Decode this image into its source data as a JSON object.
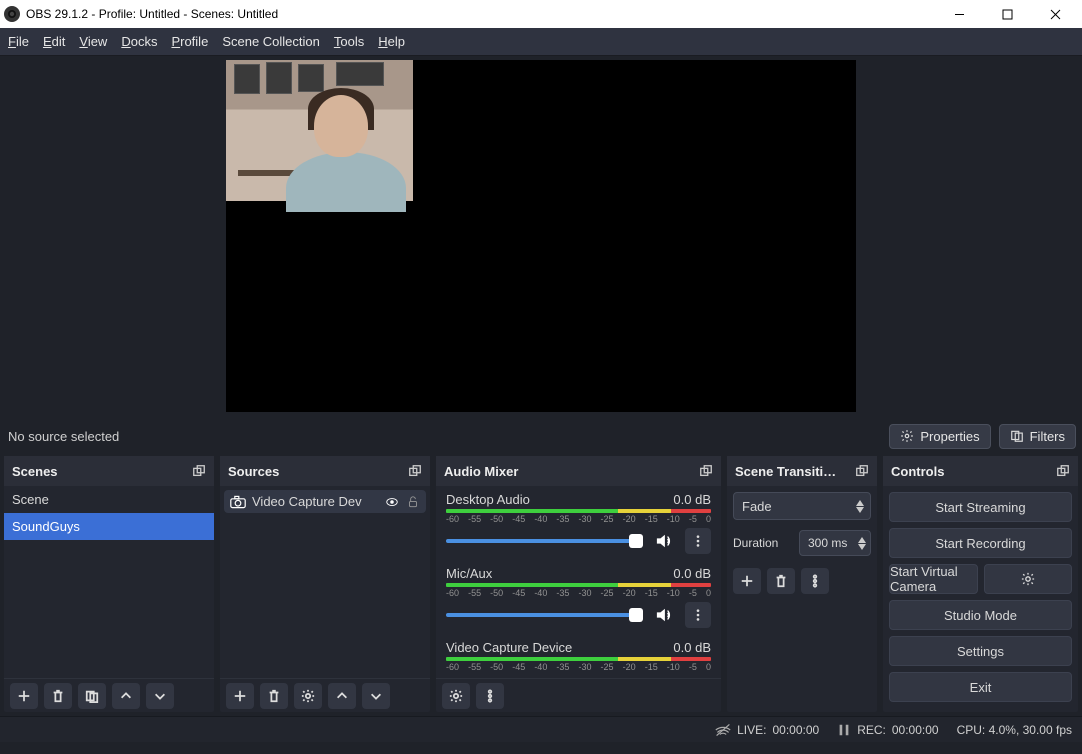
{
  "titlebar": {
    "text": "OBS 29.1.2 - Profile: Untitled - Scenes: Untitled"
  },
  "menu": {
    "file": "File",
    "edit": "Edit",
    "view": "View",
    "docks": "Docks",
    "profile": "Profile",
    "scene_collection": "Scene Collection",
    "tools": "Tools",
    "help": "Help"
  },
  "toolbar": {
    "no_source": "No source selected",
    "properties": "Properties",
    "filters": "Filters"
  },
  "docks": {
    "scenes": "Scenes",
    "sources": "Sources",
    "mixer": "Audio Mixer",
    "transitions": "Scene Transiti…",
    "controls": "Controls"
  },
  "scenes": {
    "items": [
      {
        "label": "Scene"
      },
      {
        "label": "SoundGuys"
      }
    ]
  },
  "sources": {
    "items": [
      {
        "label": "Video Capture Dev"
      }
    ]
  },
  "mixer": {
    "ticks": [
      "-60",
      "-55",
      "-50",
      "-45",
      "-40",
      "-35",
      "-30",
      "-25",
      "-20",
      "-15",
      "-10",
      "-5",
      "0"
    ],
    "channels": [
      {
        "name": "Desktop Audio",
        "level": "0.0 dB"
      },
      {
        "name": "Mic/Aux",
        "level": "0.0 dB"
      },
      {
        "name": "Video Capture Device",
        "level": "0.0 dB"
      }
    ]
  },
  "transitions": {
    "selected": "Fade",
    "duration_label": "Duration",
    "duration_value": "300 ms"
  },
  "controls": {
    "start_streaming": "Start Streaming",
    "start_recording": "Start Recording",
    "start_virtual": "Start Virtual Camera",
    "studio_mode": "Studio Mode",
    "settings": "Settings",
    "exit": "Exit"
  },
  "status": {
    "live_label": "LIVE:",
    "live_time": "00:00:00",
    "rec_label": "REC:",
    "rec_time": "00:00:00",
    "cpu": "CPU: 4.0%, 30.00 fps"
  }
}
